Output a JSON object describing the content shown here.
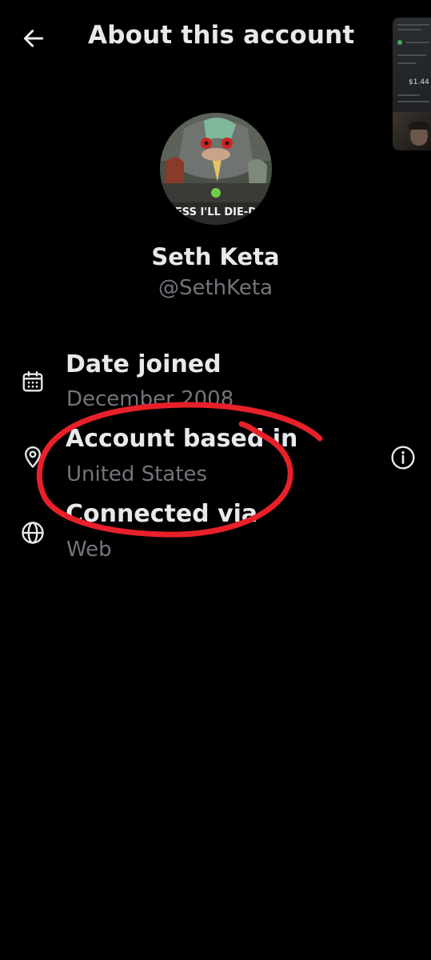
{
  "header": {
    "title": "About this account",
    "back_icon": "arrow-left-icon"
  },
  "profile": {
    "display_name": "Seth Keta",
    "handle": "@SethKeta",
    "avatar_caption": "ESS I'LL DIE-D"
  },
  "details": [
    {
      "icon": "calendar-icon",
      "label": "Date joined",
      "value": "December 2008"
    },
    {
      "icon": "location-pin-icon",
      "label": "Account based in",
      "value": "United States"
    },
    {
      "icon": "globe-icon",
      "label": "Connected via",
      "value": "Web"
    }
  ],
  "pip_overlay": {
    "price": "$1.44"
  },
  "colors": {
    "background": "#000000",
    "primary_text": "#e7e9ea",
    "secondary_text": "#71767b",
    "annotation": "#e8202a"
  }
}
